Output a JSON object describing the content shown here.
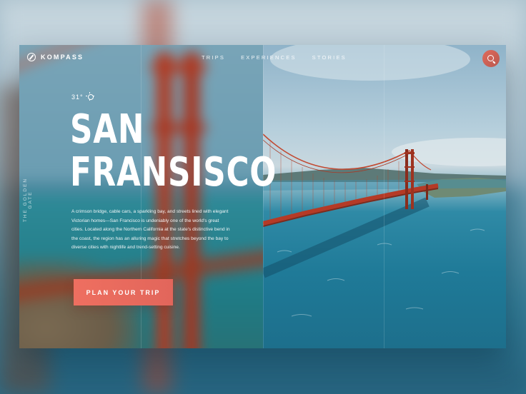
{
  "brand": {
    "name": "KOMPASS",
    "icon": "compass-icon"
  },
  "nav": {
    "items": [
      "TRIPS",
      "EXPERIENCES",
      "STORIES"
    ]
  },
  "search": {
    "icon": "search-icon",
    "accent": "#e06a5c"
  },
  "weather": {
    "temperature": "31°",
    "icon": "sun-icon"
  },
  "side_label": "THE GOLDEN GATE",
  "hero": {
    "title_line1": "SAN",
    "title_line2": "FRANSISCO",
    "description": "A crimson bridge, cable cars, a sparkling bay, and streets lined with elegant Victorian homes—San Francisco is undeniably one of the world's great cities. Located along the Northern California at the state's distinctive bend in the coast, the region has an alluring magic that stretches beyond the bay to diverse cities with nightlife and trend-setting cuisine.",
    "cta_label": "PLAN YOUR TRIP"
  },
  "colors": {
    "cta": "#ee6f60",
    "text": "#ffffff"
  }
}
